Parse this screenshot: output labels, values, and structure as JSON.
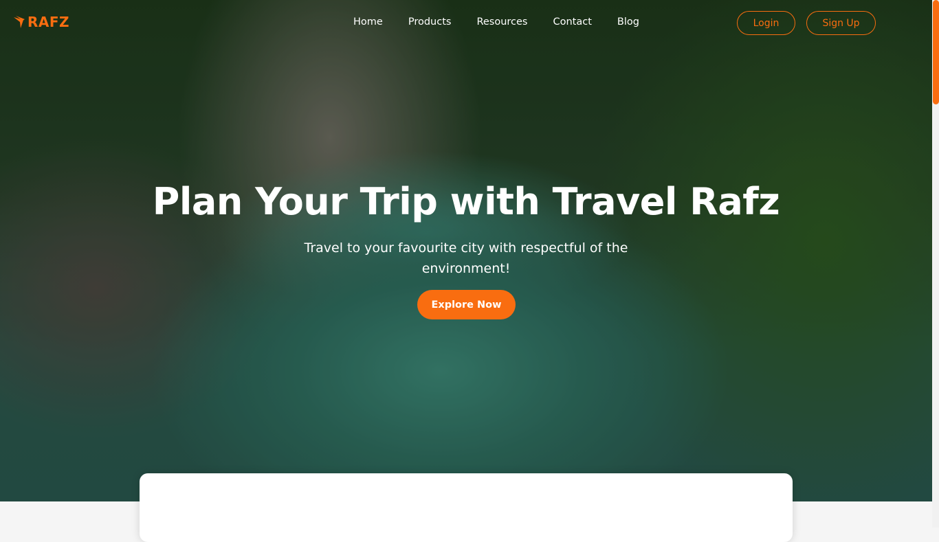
{
  "brand": {
    "name": "RAFZ",
    "accent": "#f96d10"
  },
  "nav": {
    "links": [
      "Home",
      "Products",
      "Resources",
      "Contact",
      "Blog"
    ],
    "login": "Login",
    "signup": "Sign Up"
  },
  "hero": {
    "title": "Plan Your Trip with Travel Rafz",
    "subtitle": "Travel to your favourite city with respectful of the environment!",
    "cta": "Explore Now"
  }
}
